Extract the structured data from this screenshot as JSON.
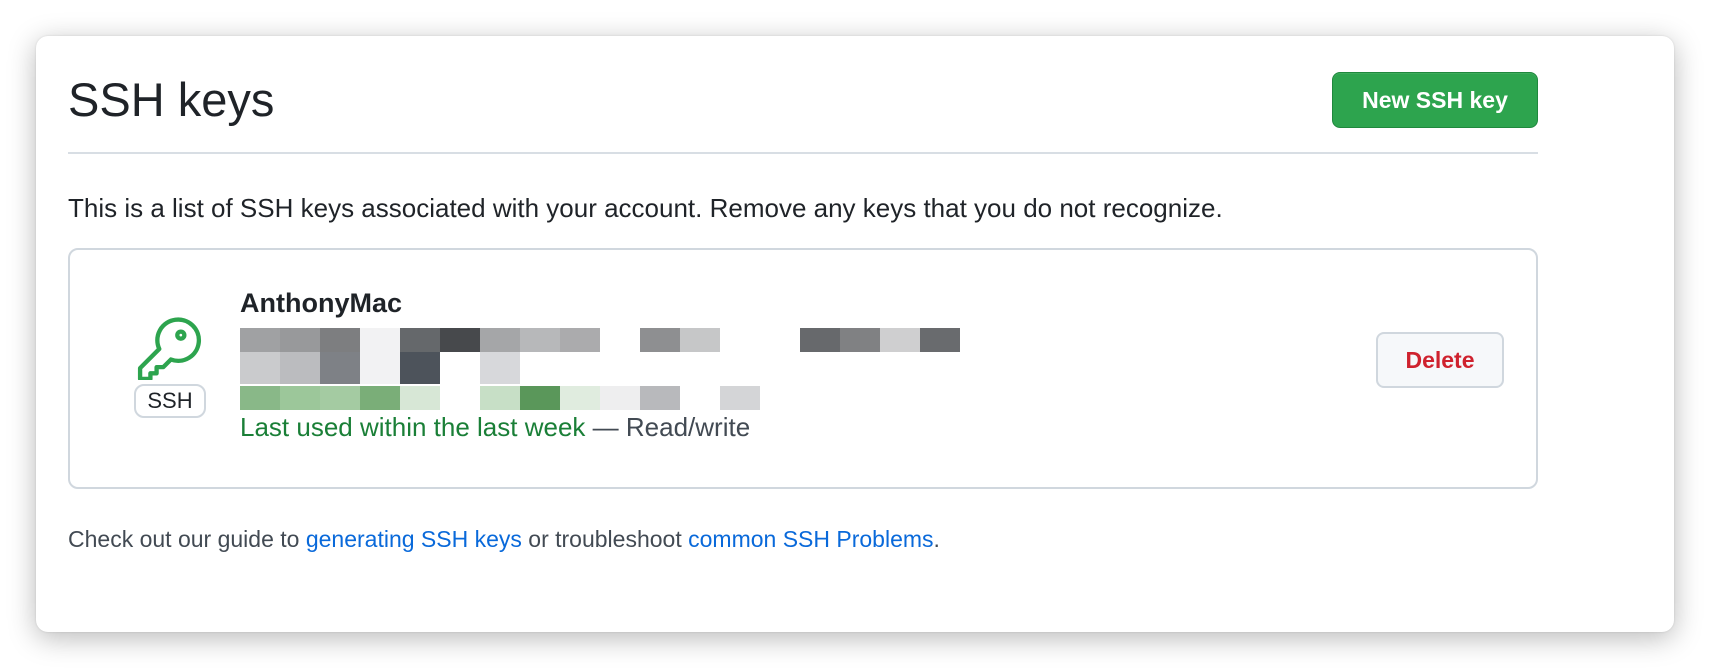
{
  "header": {
    "title": "SSH keys",
    "new_key_button": "New SSH key"
  },
  "intro_text": "This is a list of SSH keys associated with your account. Remove any keys that you do not recognize.",
  "keys": [
    {
      "name": "AnthonyMac",
      "type_badge": "SSH",
      "last_used": "Last used within the last week",
      "separator": " — ",
      "access": "Read/write",
      "delete_button": "Delete"
    }
  ],
  "footer": {
    "prefix": "Check out our guide to ",
    "link1": "generating SSH keys",
    "middle": " or troubleshoot ",
    "link2": "common SSH Problems",
    "suffix": "."
  },
  "icons": {
    "key": "key-icon"
  },
  "colors": {
    "primary_button": "#2da44e",
    "danger_text": "#cf222e",
    "link": "#0969da",
    "success_text": "#1a7f37",
    "key_icon": "#2da44e"
  }
}
